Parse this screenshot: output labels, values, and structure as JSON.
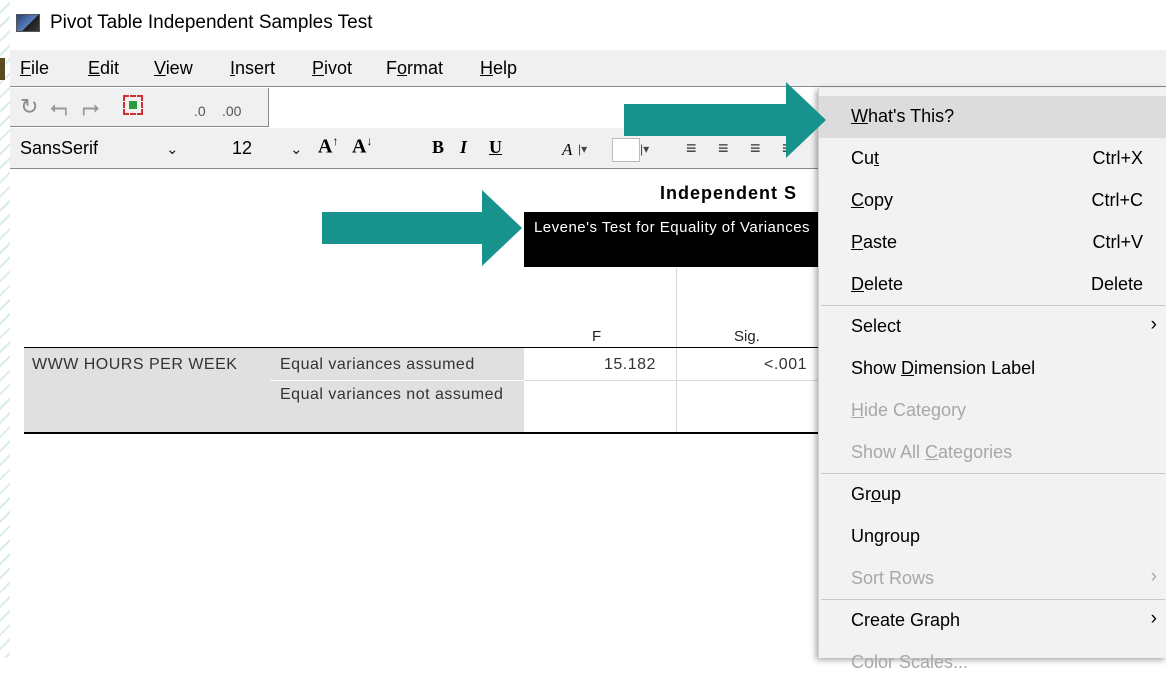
{
  "window": {
    "title": "Pivot Table Independent Samples Test"
  },
  "menu": {
    "items": [
      {
        "pre": "",
        "u": "F",
        "post": "ile"
      },
      {
        "pre": "",
        "u": "E",
        "post": "dit"
      },
      {
        "pre": "",
        "u": "V",
        "post": "iew"
      },
      {
        "pre": "",
        "u": "I",
        "post": "nsert"
      },
      {
        "pre": "",
        "u": "P",
        "post": "ivot"
      },
      {
        "pre": "F",
        "u": "o",
        "post": "rmat"
      },
      {
        "pre": "",
        "u": "H",
        "post": "elp"
      }
    ]
  },
  "format_toolbar": {
    "font_name": "SansSerif",
    "font_size": "12",
    "bold": "B",
    "italic": "I",
    "underline": "U",
    "text_color_glyph": "A"
  },
  "table": {
    "title": "Independent S",
    "levene_header": "Levene's Test for Equality of Variances",
    "col_f": "F",
    "col_sig": "Sig.",
    "row_label": "WWW HOURS PER WEEK",
    "row1_label": "Equal variances assumed",
    "row1_f": "15.182",
    "row1_sig": "<.001",
    "row2_label": "Equal variances not assumed"
  },
  "context_menu": {
    "items": [
      {
        "pre": "",
        "u": "W",
        "post": "hat's This?",
        "key": "",
        "arrow": false,
        "disabled": false,
        "hl": true,
        "name": "ctx-whats-this"
      },
      {
        "pre": "Cu",
        "u": "t",
        "post": "",
        "key": "Ctrl+X",
        "arrow": false,
        "disabled": false,
        "hl": false,
        "name": "ctx-cut"
      },
      {
        "pre": "",
        "u": "C",
        "post": "opy",
        "key": "Ctrl+C",
        "arrow": false,
        "disabled": false,
        "hl": false,
        "name": "ctx-copy"
      },
      {
        "pre": "",
        "u": "P",
        "post": "aste",
        "key": "Ctrl+V",
        "arrow": false,
        "disabled": false,
        "hl": false,
        "name": "ctx-paste"
      },
      {
        "pre": "",
        "u": "D",
        "post": "elete",
        "key": "Delete",
        "arrow": false,
        "disabled": false,
        "hl": false,
        "name": "ctx-delete"
      },
      {
        "pre": "Select",
        "u": "",
        "post": "",
        "key": "",
        "arrow": true,
        "disabled": false,
        "hl": false,
        "name": "ctx-select"
      },
      {
        "pre": "Show ",
        "u": "D",
        "post": "imension Label",
        "key": "",
        "arrow": false,
        "disabled": false,
        "hl": false,
        "name": "ctx-show-dimension-label"
      },
      {
        "pre": "",
        "u": "H",
        "post": "ide Category",
        "key": "",
        "arrow": false,
        "disabled": true,
        "hl": false,
        "name": "ctx-hide-category"
      },
      {
        "pre": "Show All ",
        "u": "C",
        "post": "ategories",
        "key": "",
        "arrow": false,
        "disabled": true,
        "hl": false,
        "name": "ctx-show-all-categories"
      },
      {
        "pre": "Gr",
        "u": "o",
        "post": "up",
        "key": "",
        "arrow": false,
        "disabled": false,
        "hl": false,
        "name": "ctx-group"
      },
      {
        "pre": "Un",
        "u": "g",
        "post": "roup",
        "key": "",
        "arrow": false,
        "disabled": false,
        "hl": false,
        "name": "ctx-ungroup"
      },
      {
        "pre": "Sort Rows",
        "u": "",
        "post": "",
        "key": "",
        "arrow": true,
        "disabled": true,
        "hl": false,
        "name": "ctx-sort-rows"
      },
      {
        "pre": "Create Graph",
        "u": "",
        "post": "",
        "key": "",
        "arrow": true,
        "disabled": false,
        "hl": false,
        "name": "ctx-create-graph"
      },
      {
        "pre": "Color Scales...",
        "u": "",
        "post": "",
        "key": "",
        "arrow": false,
        "disabled": true,
        "hl": false,
        "name": "ctx-color-scales"
      }
    ],
    "submenu_arrow": "›"
  },
  "colors": {
    "arrow": "#17928c",
    "header_bg": "#000000",
    "menu_highlight": "#dcdcdc"
  }
}
